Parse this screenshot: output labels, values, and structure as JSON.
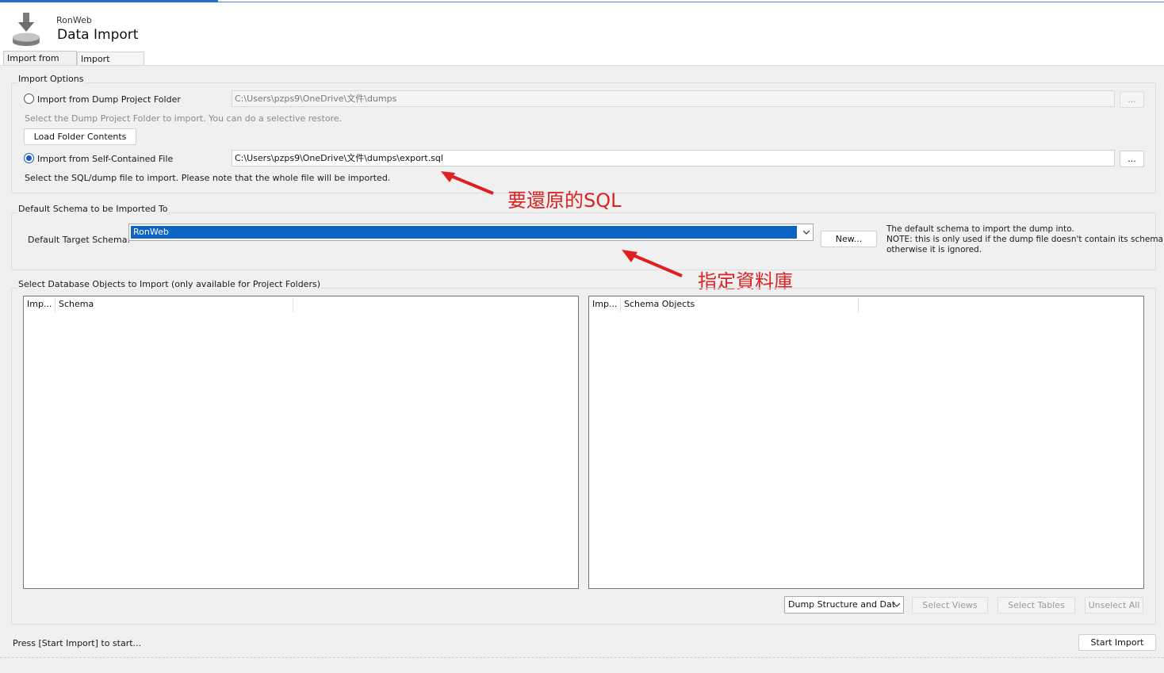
{
  "header": {
    "connection_name": "RonWeb",
    "title": "Data Import"
  },
  "tabs": [
    {
      "label": "Import from Disk",
      "active": true
    },
    {
      "label": "Import Progress",
      "active": false
    }
  ],
  "import_options": {
    "title": "Import Options",
    "dump_folder": {
      "label": "Import from Dump Project Folder",
      "path": "C:\\Users\\pzps9\\OneDrive\\文件\\dumps",
      "browse_label": "...",
      "hint": "Select the Dump Project Folder to import. You can do a selective restore.",
      "load_button": "Load Folder Contents",
      "selected": false
    },
    "self_contained": {
      "label": "Import from Self-Contained File",
      "path": "C:\\Users\\pzps9\\OneDrive\\文件\\dumps\\export.sql",
      "browse_label": "...",
      "hint": "Select the SQL/dump file to import. Please note that the whole file will be imported.",
      "selected": true
    }
  },
  "default_schema": {
    "title": "Default Schema to be Imported To",
    "target_label": "Default Target Schema:",
    "target_value": "RonWeb",
    "new_button": "New...",
    "note_line1": "The default schema to import the dump into.",
    "note_line2": "NOTE: this is only used if the dump file doesn't contain its schema,",
    "note_line3": "otherwise it is ignored."
  },
  "objects": {
    "title": "Select Database Objects to Import (only available for Project Folders)",
    "left_columns": [
      "Imp...",
      "Schema"
    ],
    "right_columns": [
      "Imp...",
      "Schema Objects"
    ],
    "dump_mode": "Dump Structure and Dat",
    "select_views": "Select Views",
    "select_tables": "Select Tables",
    "unselect_all": "Unselect All"
  },
  "footer": {
    "status": "Press [Start Import] to start...",
    "start_button": "Start Import"
  },
  "annotations": {
    "sql_note": "要還原的SQL",
    "db_note": "指定資料庫"
  },
  "colors": {
    "accent": "#0e63c7",
    "annotation": "#e02020",
    "background": "#f0f0f0"
  }
}
